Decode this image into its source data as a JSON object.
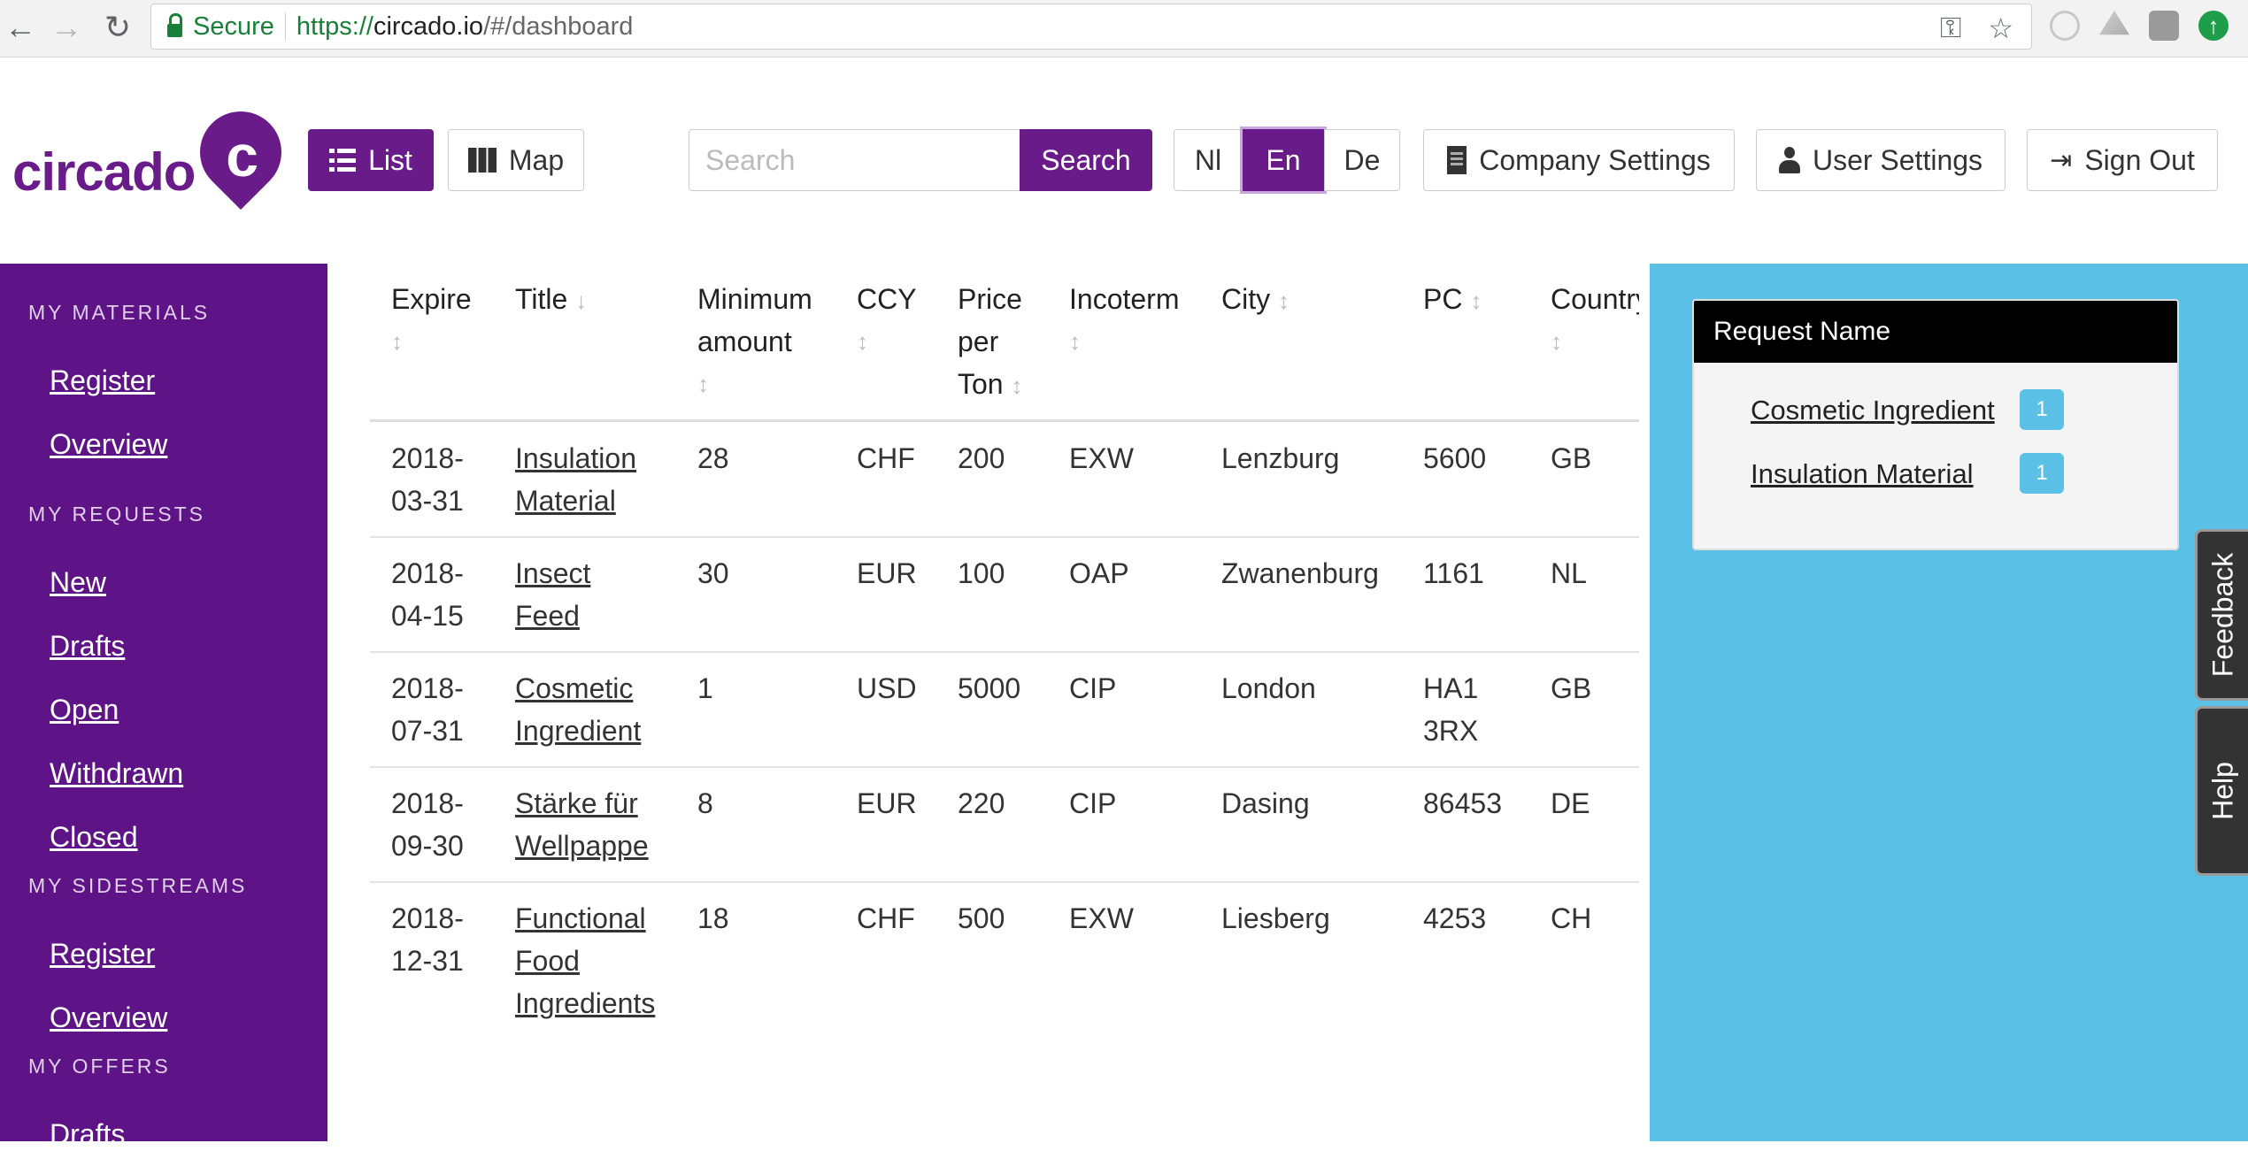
{
  "browser": {
    "secure_label": "Secure",
    "url_scheme": "https://",
    "url_host": "circado.io",
    "url_path": "/#/dashboard"
  },
  "header": {
    "logo_text": "circado",
    "logo_mark": "c",
    "view_list": "List",
    "view_map": "Map",
    "search_placeholder": "Search",
    "search_button": "Search",
    "languages": [
      "Nl",
      "En",
      "De"
    ],
    "active_language": "En",
    "company_settings": "Company Settings",
    "user_settings": "User Settings",
    "sign_out": "Sign Out"
  },
  "sidebar": {
    "sections": [
      {
        "title": "MY MATERIALS",
        "items": [
          "Register",
          "Overview"
        ]
      },
      {
        "title": "MY REQUESTS",
        "items": [
          "New",
          "Drafts",
          "Open",
          "Withdrawn",
          "Closed"
        ]
      },
      {
        "title": "MY SIDESTREAMS",
        "items": [
          "Register",
          "Overview"
        ]
      },
      {
        "title": "MY OFFERS",
        "items": [
          "Drafts"
        ]
      }
    ]
  },
  "table": {
    "headers": {
      "expire": "Expire",
      "title": "Title",
      "min_amount_1": "Minimum",
      "min_amount_2": "amount",
      "ccy": "CCY",
      "price_1": "Price",
      "price_2": "per",
      "price_3": "Ton",
      "incoterm": "Incoterm",
      "city": "City",
      "pc": "PC",
      "country": "Country"
    },
    "rows": [
      {
        "expire_1": "2018-",
        "expire_2": "03-31",
        "title_1": "Insulation",
        "title_2": "Material",
        "title_3": "",
        "min": "28",
        "ccy": "CHF",
        "price": "200",
        "incoterm": "EXW",
        "city": "Lenzburg",
        "pc_1": "5600",
        "pc_2": "",
        "country": "GB"
      },
      {
        "expire_1": "2018-",
        "expire_2": "04-15",
        "title_1": "Insect",
        "title_2": "Feed",
        "title_3": "",
        "min": "30",
        "ccy": "EUR",
        "price": "100",
        "incoterm": "OAP",
        "city": "Zwanenburg",
        "pc_1": "1161",
        "pc_2": "",
        "country": "NL"
      },
      {
        "expire_1": "2018-",
        "expire_2": "07-31",
        "title_1": "Cosmetic",
        "title_2": "Ingredient",
        "title_3": "",
        "min": "1",
        "ccy": "USD",
        "price": "5000",
        "incoterm": "CIP",
        "city": "London",
        "pc_1": "HA1",
        "pc_2": "3RX",
        "country": "GB"
      },
      {
        "expire_1": "2018-",
        "expire_2": "09-30",
        "title_1": "Stärke für",
        "title_2": "Wellpappe",
        "title_3": "",
        "min": "8",
        "ccy": "EUR",
        "price": "220",
        "incoterm": "CIP",
        "city": "Dasing",
        "pc_1": "86453",
        "pc_2": "",
        "country": "DE"
      },
      {
        "expire_1": "2018-",
        "expire_2": "12-31",
        "title_1": "Functional",
        "title_2": "Food",
        "title_3": "Ingredients",
        "min": "18",
        "ccy": "CHF",
        "price": "500",
        "incoterm": "EXW",
        "city": "Liesberg",
        "pc_1": "4253",
        "pc_2": "",
        "country": "CH"
      }
    ]
  },
  "requests_panel": {
    "header": "Request Name",
    "items": [
      {
        "name": "Cosmetic Ingredient",
        "count": "1"
      },
      {
        "name": "Insulation Material",
        "count": "1"
      }
    ]
  },
  "side_tabs": {
    "feedback": "Feedback",
    "help": "Help"
  },
  "colors": {
    "brand_purple": "#6a1b8a",
    "sidebar_purple": "#5e1387",
    "panel_blue": "#5bc0e6"
  },
  "icons": [
    "back-arrow-icon",
    "forward-arrow-icon",
    "reload-icon",
    "lock-icon",
    "key-icon",
    "star-icon",
    "list-icon",
    "map-icon",
    "building-icon",
    "user-icon",
    "sign-out-icon",
    "sort-icon",
    "sort-down-icon"
  ]
}
